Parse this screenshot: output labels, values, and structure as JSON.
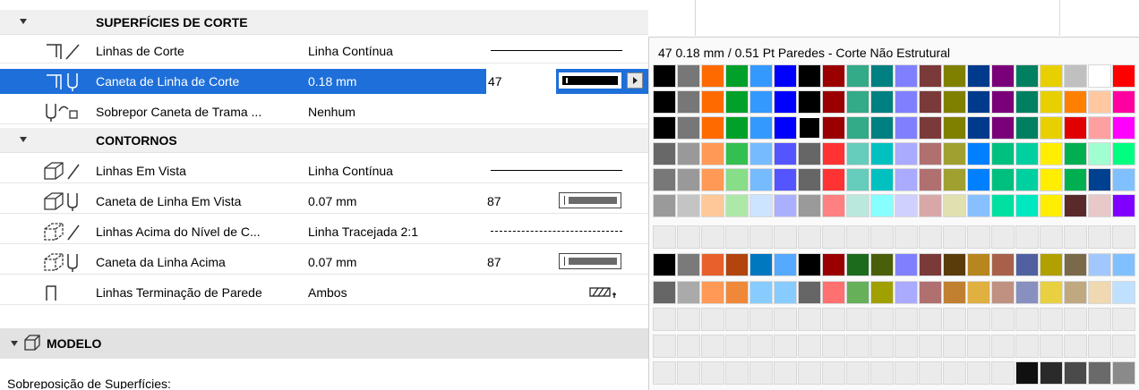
{
  "sections": {
    "corte": "SUPERFÍCIES DE CORTE",
    "contornos": "CONTORNOS",
    "modelo": "MODELO"
  },
  "rows": {
    "linhas_corte": {
      "label": "Linhas de Corte",
      "value": "Linha Contínua"
    },
    "caneta_corte": {
      "label": "Caneta de Linha de Corte",
      "value": "0.18 mm",
      "pen": "47"
    },
    "sobrepor": {
      "label": "Sobrepor Caneta de Trama ...",
      "value": "Nenhum"
    },
    "linhas_vista": {
      "label": "Linhas Em Vista",
      "value": "Linha Contínua"
    },
    "caneta_vista": {
      "label": "Caneta de Linha Em Vista",
      "value": "0.07 mm",
      "pen": "87"
    },
    "linhas_acima": {
      "label": "Linhas Acima do Nível de C...",
      "value": "Linha Tracejada 2:1"
    },
    "caneta_acima": {
      "label": "Caneta da Linha Acima",
      "value": "0.07 mm",
      "pen": "87"
    },
    "terminacao": {
      "label": "Linhas Terminação de Parede",
      "value": "Ambos"
    }
  },
  "subheading": "Sobreposição de Superfícies:",
  "palette": {
    "title": "47  0.18 mm / 0.51 Pt Paredes - Corte Não Estrutural",
    "selected_index": 2,
    "columns": [
      [
        "#000000",
        "#000000",
        "#000000",
        "#686868",
        "#787878",
        "#9a9a9a",
        "",
        "#000000",
        "#666666",
        "",
        "",
        ""
      ],
      [
        "#777777",
        "#777777",
        "#777777",
        "#999999",
        "#999999",
        "#c4c4c4",
        "",
        "#7a7a7a",
        "#aaaaaa",
        "",
        "",
        ""
      ],
      [
        "#ff6a00",
        "#ff6a00",
        "#ff6a00",
        "#ff9955",
        "#ff9955",
        "#ffc898",
        "",
        "#e8612c",
        "#ff9955",
        "",
        "",
        ""
      ],
      [
        "#00a02a",
        "#00a02a",
        "#00a02a",
        "#33c050",
        "#88dd88",
        "#aee8a8",
        "",
        "#b1450d",
        "#f0883a",
        "",
        "",
        ""
      ],
      [
        "#3399ff",
        "#3399ff",
        "#3399ff",
        "#77bbff",
        "#77bbff",
        "#cce4ff",
        "",
        "#0078c0",
        "#88ccff",
        "",
        "",
        ""
      ],
      [
        "#0000ff",
        "#0000ff",
        "#0000ff",
        "#5555ff",
        "#5555ff",
        "#aab0ff",
        "",
        "#55aaff",
        "#88ccff",
        "",
        "",
        ""
      ],
      [
        "#000000",
        "#000000",
        "#000000",
        "#666666",
        "#666666",
        "#9a9a9a",
        "",
        "#000000",
        "#666666",
        "",
        "",
        ""
      ],
      [
        "#9b0000",
        "#9b0000",
        "#9b0000",
        "#ff3333",
        "#ff3333",
        "#ff8080",
        "",
        "#9b0000",
        "#ff7070",
        "",
        "",
        ""
      ],
      [
        "#33aa88",
        "#33aa88",
        "#33aa88",
        "#66ccbb",
        "#66ccbb",
        "#bbe8dd",
        "",
        "#1c6b1c",
        "#66b05a",
        "",
        "",
        ""
      ],
      [
        "#008080",
        "#008080",
        "#008080",
        "#00c0c0",
        "#00c0c0",
        "#88ffff",
        "",
        "#4a5f0a",
        "#a0a000",
        "",
        "",
        ""
      ],
      [
        "#8080ff",
        "#8080ff",
        "#8080ff",
        "#aaaaff",
        "#aaaaff",
        "#d0d0ff",
        "",
        "#8080ff",
        "#aaaaff",
        "",
        "",
        ""
      ],
      [
        "#7b3a3a",
        "#7b3a3a",
        "#7b3a3a",
        "#b07070",
        "#b07070",
        "#d8a8a8",
        "",
        "#7b3a3a",
        "#b07070",
        "",
        "",
        ""
      ],
      [
        "#808000",
        "#808000",
        "#808000",
        "#a0a030",
        "#a0a030",
        "#e0e0b0",
        "",
        "#5a3c0a",
        "#c08030",
        "",
        "",
        ""
      ],
      [
        "#003a8c",
        "#003a8c",
        "#003a8c",
        "#0080ff",
        "#0080ff",
        "#88c0ff",
        "",
        "#b8861e",
        "#e0b040",
        "",
        "",
        ""
      ],
      [
        "#7a007a",
        "#7a007a",
        "#7a007a",
        "#00c080",
        "#00c080",
        "#00e0a0",
        "",
        "#a8604a",
        "#c09080",
        "",
        "",
        ""
      ],
      [
        "#008060",
        "#008060",
        "#008060",
        "#00d0a0",
        "#00d0a0",
        "#00e8c0",
        "",
        "#5060a0",
        "#8890c0",
        "",
        "",
        "#101010"
      ],
      [
        "#e8d000",
        "#e8d000",
        "#e8d000",
        "#ffee00",
        "#ffee00",
        "#ffee00",
        "",
        "#b0a000",
        "#e8d040",
        "",
        "",
        "#2a2a2a"
      ],
      [
        "#c0c0c0",
        "#ff8000",
        "#e00000",
        "#00b050",
        "#00b050",
        "#5a2a2a",
        "",
        "#7a6a4a",
        "#c0a880",
        "",
        "",
        "#4a4a4a"
      ],
      [
        "#ffffff",
        "#ffc8a0",
        "#ffa0a0",
        "#a0ffd0",
        "#004090",
        "#e8c8c8",
        "",
        "#a0c8ff",
        "#f0d8b0",
        "",
        "",
        "#6a6a6a"
      ],
      [
        "#ff0000",
        "#ff00a0",
        "#ff00ff",
        "#00ff80",
        "#80c0ff",
        "#8000ff",
        "",
        "#80c0ff",
        "#c0e0ff",
        "",
        "",
        "#8a8a8a"
      ]
    ]
  }
}
